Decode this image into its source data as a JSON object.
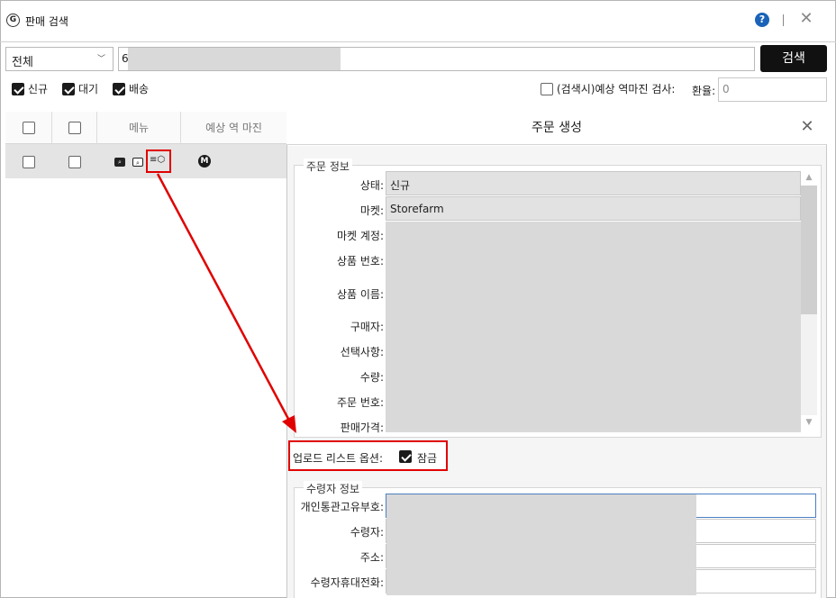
{
  "window": {
    "title": "판매 검색",
    "app_icon": "G"
  },
  "toolbar": {
    "filter_value": "전체",
    "search_value": "6",
    "search_button": "검색",
    "checkboxes": [
      {
        "label": "신규",
        "checked": true
      },
      {
        "label": "대기",
        "checked": true
      },
      {
        "label": "배송",
        "checked": true
      }
    ],
    "margin_check_label": "(검색시)예상 역마진 검사:",
    "rate_label": "환율:",
    "rate_placeholder": "0"
  },
  "grid": {
    "headers": [
      "메뉴",
      "예상 역 마진"
    ],
    "rows": [
      {
        "m_badge": "M"
      }
    ]
  },
  "panel": {
    "title": "주문 생성",
    "order_group": {
      "title": "주문 정보",
      "fields": [
        {
          "label": "상태:",
          "value": "신규"
        },
        {
          "label": "마켓:",
          "value": "Storefarm"
        },
        {
          "label": "마켓 계정:",
          "value": ""
        },
        {
          "label": "상품 번호:",
          "value": ""
        },
        {
          "label": "상품 이름:",
          "value": ""
        },
        {
          "label": "구매자:",
          "value": ""
        },
        {
          "label": "선택사항:",
          "value": ""
        },
        {
          "label": "수량:",
          "value": ""
        },
        {
          "label": "주문 번호:",
          "value": ""
        },
        {
          "label": "판매가격:",
          "value": ""
        }
      ]
    },
    "upload_option_label": "업로드 리스트 옵션:",
    "lock_label": "잠금",
    "recipient_group": {
      "title": "수령자 정보",
      "fields": [
        {
          "label": "개인통관고유부호:"
        },
        {
          "label": "수령자:"
        },
        {
          "label": "주소:"
        },
        {
          "label": "수령자휴대전화:"
        }
      ]
    }
  },
  "colors": {
    "highlight": "#e00000",
    "accent": "#1a63b8",
    "dark_button": "#111111"
  }
}
